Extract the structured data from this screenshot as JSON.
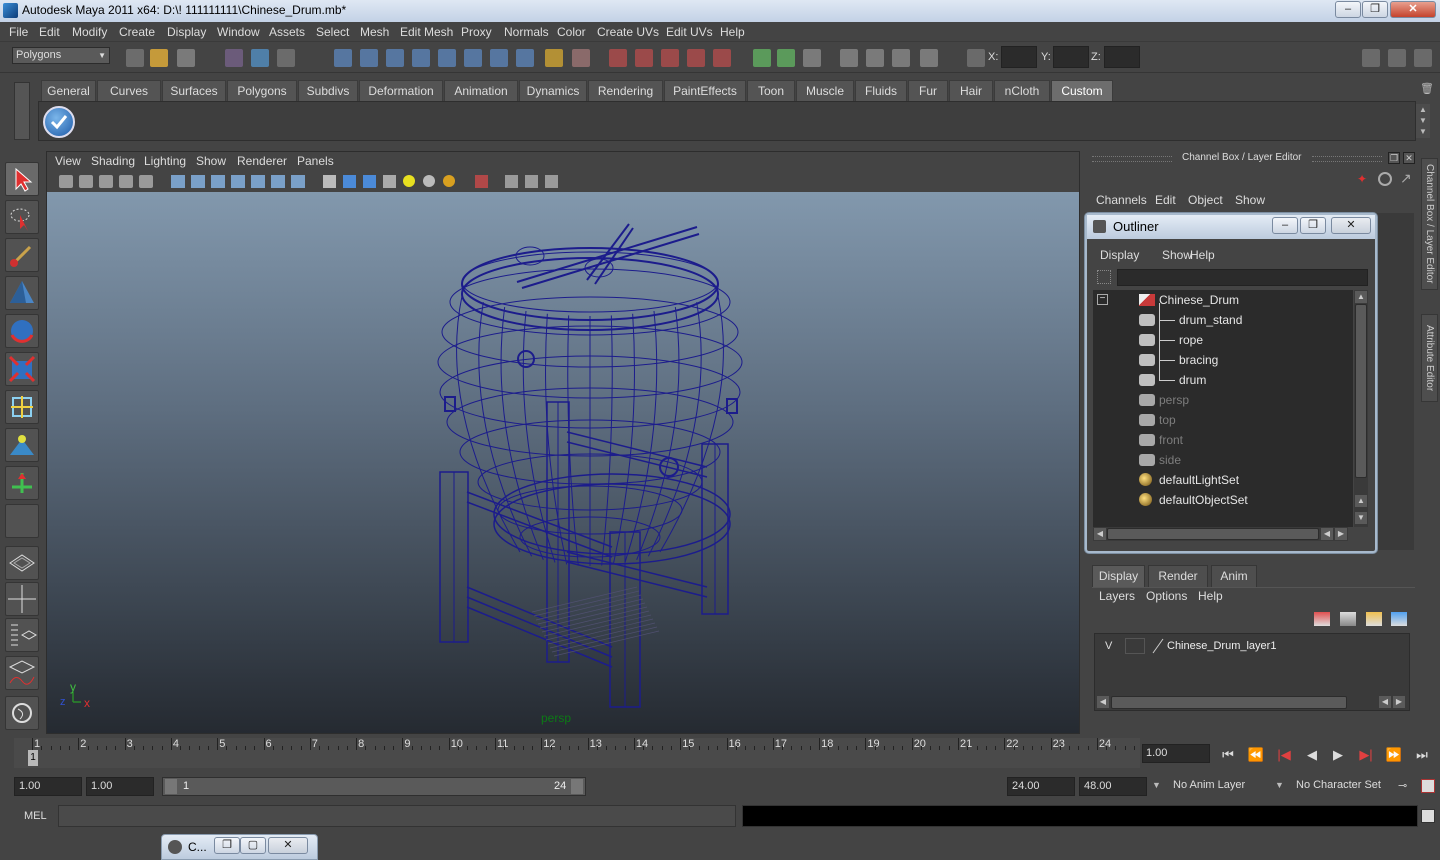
{
  "window": {
    "title": "Autodesk Maya 2011 x64: D:\\! 111111111\\Chinese_Drum.mb*",
    "minimize": "‒",
    "maximize": "❐",
    "close": "✕"
  },
  "menubar": [
    "File",
    "Edit",
    "Modify",
    "Create",
    "Display",
    "Window",
    "Assets",
    "Select",
    "Mesh",
    "Edit Mesh",
    "Proxy",
    "Normals",
    "Color",
    "Create UVs",
    "Edit UVs",
    "Help"
  ],
  "statusline": {
    "mode": "Polygons",
    "x_label": "X:",
    "y_label": "Y:",
    "z_label": "Z:"
  },
  "shelf": {
    "tabs": [
      "General",
      "Curves",
      "Surfaces",
      "Polygons",
      "Subdivs",
      "Deformation",
      "Animation",
      "Dynamics",
      "Rendering",
      "PaintEffects",
      "Toon",
      "Muscle",
      "Fluids",
      "Fur",
      "Hair",
      "nCloth",
      "Custom"
    ],
    "active_tab": "Custom",
    "icons": [
      "checkmark-icon"
    ]
  },
  "viewport": {
    "menu": [
      "View",
      "Shading",
      "Lighting",
      "Show",
      "Renderer",
      "Panels"
    ],
    "camera_label": "persp",
    "axis_y": "y",
    "axis_z": "z",
    "axis_x": "x",
    "wire_color": "#1c1c8c"
  },
  "channel_box": {
    "title": "Channel Box / Layer Editor",
    "menu": [
      "Channels",
      "Edit",
      "Object",
      "Show"
    ]
  },
  "outliner": {
    "title": "Outliner",
    "menu": [
      "Display",
      "Show",
      "Help"
    ],
    "items": [
      {
        "name": "Chinese_Drum",
        "type": "group",
        "dim": false,
        "indent": 0
      },
      {
        "name": "drum_stand",
        "type": "mesh",
        "dim": false,
        "indent": 1
      },
      {
        "name": "rope",
        "type": "mesh",
        "dim": false,
        "indent": 1
      },
      {
        "name": "bracing",
        "type": "mesh",
        "dim": false,
        "indent": 1
      },
      {
        "name": "drum",
        "type": "mesh",
        "dim": false,
        "indent": 1
      },
      {
        "name": "persp",
        "type": "camera",
        "dim": true,
        "indent": 0
      },
      {
        "name": "top",
        "type": "camera",
        "dim": true,
        "indent": 0
      },
      {
        "name": "front",
        "type": "camera",
        "dim": true,
        "indent": 0
      },
      {
        "name": "side",
        "type": "camera",
        "dim": true,
        "indent": 0
      },
      {
        "name": "defaultLightSet",
        "type": "set",
        "dim": false,
        "indent": 0
      },
      {
        "name": "defaultObjectSet",
        "type": "set",
        "dim": false,
        "indent": 0
      }
    ]
  },
  "layer_editor": {
    "tabs": [
      "Display",
      "Render",
      "Anim"
    ],
    "active_tab": "Display",
    "menu": [
      "Layers",
      "Options",
      "Help"
    ],
    "layers": [
      {
        "visible": "V",
        "name": "Chinese_Drum_layer1"
      }
    ]
  },
  "side_tabs": [
    "Channel Box / Layer Editor",
    "Attribute Editor"
  ],
  "timeline": {
    "frames": [
      "1",
      "2",
      "3",
      "4",
      "5",
      "6",
      "7",
      "8",
      "9",
      "10",
      "11",
      "12",
      "13",
      "14",
      "15",
      "16",
      "17",
      "18",
      "19",
      "20",
      "21",
      "22",
      "23",
      "24"
    ],
    "current_frame_marker": "1",
    "current_time": "1.00",
    "playback_buttons": [
      "⏮",
      "⏪",
      "|◀",
      "◀",
      "▶",
      "▶|",
      "⏩",
      "⏭"
    ]
  },
  "range": {
    "start": "1.00",
    "playback_start": "1.00",
    "slider_start": "1",
    "slider_end": "24",
    "playback_end": "24.00",
    "end": "48.00",
    "anim_layer": "No Anim Layer",
    "character_set": "No Character Set"
  },
  "mel": {
    "label": "MEL"
  },
  "bottom_window": {
    "title": "C..."
  }
}
